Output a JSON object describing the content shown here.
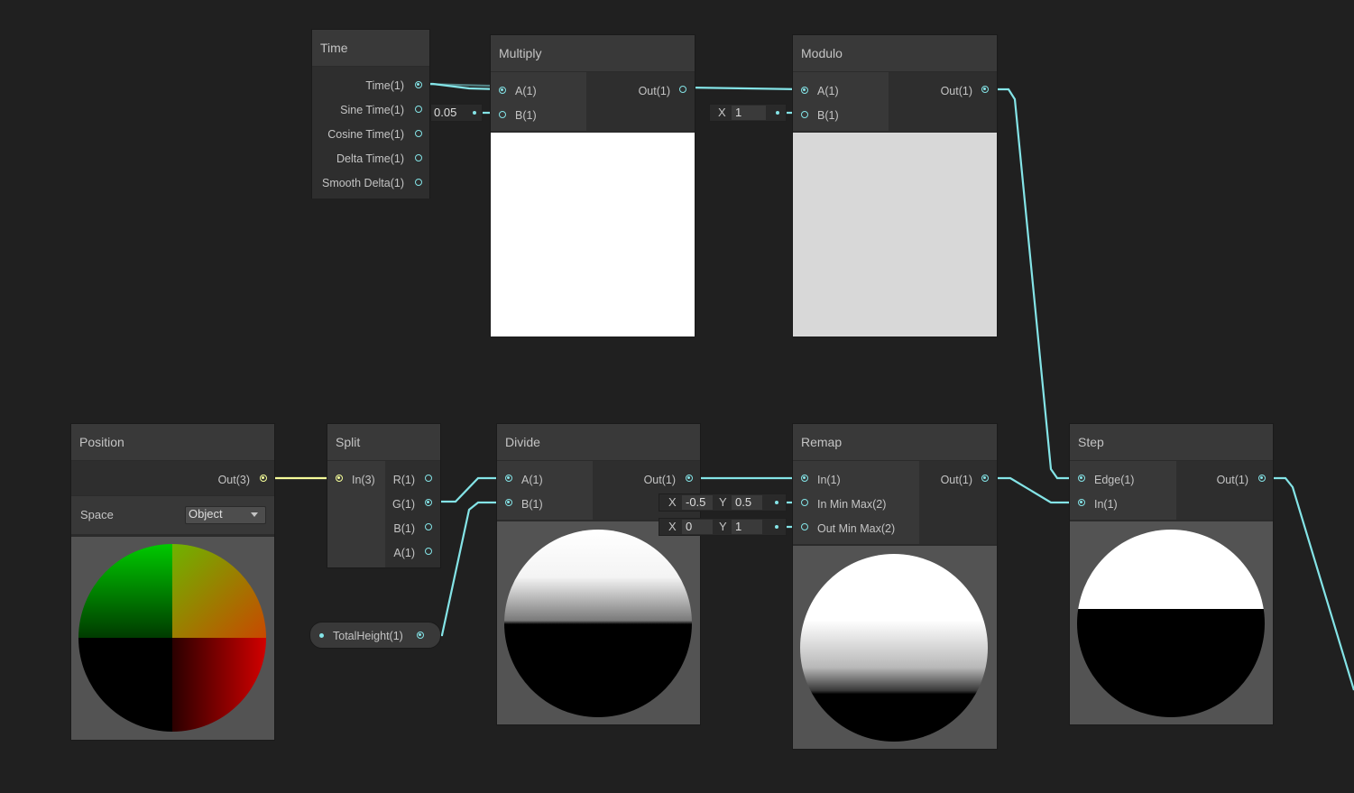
{
  "nodes": {
    "time": {
      "title": "Time",
      "outputs": [
        "Time(1)",
        "Sine Time(1)",
        "Cosine Time(1)",
        "Delta Time(1)",
        "Smooth Delta(1)"
      ]
    },
    "multiply": {
      "title": "Multiply",
      "inputs": [
        "A(1)",
        "B(1)"
      ],
      "output": "Out(1)",
      "b_field_value": "0.05"
    },
    "modulo": {
      "title": "Modulo",
      "inputs": [
        "A(1)",
        "B(1)"
      ],
      "output": "Out(1)",
      "b_field_label": "X",
      "b_field_value": "1"
    },
    "position": {
      "title": "Position",
      "output": "Out(3)",
      "space_label": "Space",
      "space_value": "Object"
    },
    "split": {
      "title": "Split",
      "input": "In(3)",
      "outputs": [
        "R(1)",
        "G(1)",
        "B(1)",
        "A(1)"
      ]
    },
    "divide": {
      "title": "Divide",
      "inputs": [
        "A(1)",
        "B(1)"
      ],
      "output": "Out(1)"
    },
    "remap": {
      "title": "Remap",
      "inputs": [
        "In(1)",
        "In Min Max(2)",
        "Out Min Max(2)"
      ],
      "output": "Out(1)",
      "in_min_max": {
        "x_label": "X",
        "x": "-0.5",
        "y_label": "Y",
        "y": "0.5"
      },
      "out_min_max": {
        "x_label": "X",
        "x": "0",
        "y_label": "Y",
        "y": "1"
      }
    },
    "step": {
      "title": "Step",
      "inputs": [
        "Edge(1)",
        "In(1)"
      ],
      "output": "Out(1)"
    },
    "total_height": {
      "label": "TotalHeight(1)"
    }
  },
  "colors": {
    "background": "#202020",
    "node_body": "#2b2b2b",
    "node_header": "#393939",
    "wire_float": "#84e4e7",
    "wire_vector3": "#f6ff9a",
    "preview_bg": "#535353"
  }
}
